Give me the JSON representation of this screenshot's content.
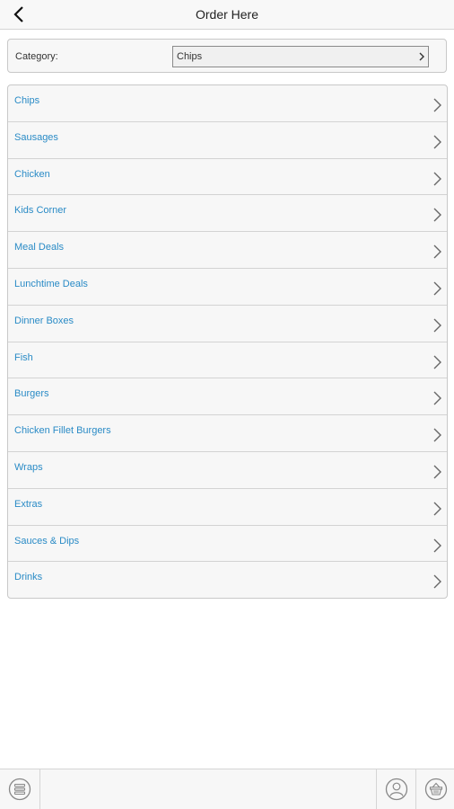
{
  "navbar": {
    "title": "Order Here",
    "back_icon": "chevron-left-icon"
  },
  "category": {
    "label": "Category:",
    "selected": "Chips"
  },
  "menu_items": [
    {
      "label": "Chips"
    },
    {
      "label": "Sausages"
    },
    {
      "label": "Chicken"
    },
    {
      "label": "Kids Corner"
    },
    {
      "label": "Meal Deals"
    },
    {
      "label": "Lunchtime Deals"
    },
    {
      "label": "Dinner Boxes"
    },
    {
      "label": "Fish"
    },
    {
      "label": "Burgers"
    },
    {
      "label": "Chicken Fillet Burgers"
    },
    {
      "label": "Wraps"
    },
    {
      "label": "Extras"
    },
    {
      "label": "Sauces & Dips"
    },
    {
      "label": "Drinks"
    }
  ],
  "tabbar": {
    "left_icon": "menu-list-icon",
    "right_icons": [
      "account-icon",
      "basket-icon"
    ]
  },
  "colors": {
    "link": "#2a8bc6",
    "panel": "#f7f7f7",
    "border": "#c8c8c8"
  }
}
